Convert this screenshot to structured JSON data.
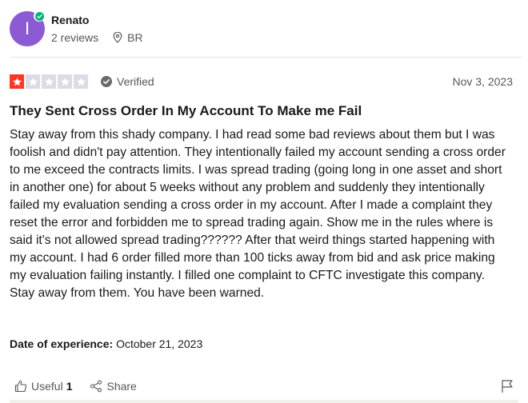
{
  "reviewer": {
    "avatar_initial": "I",
    "name": "Renato",
    "reviews_count": "2 reviews",
    "location": "BR",
    "avatar_color": "#8c5ad2"
  },
  "rating": {
    "stars_filled": 1,
    "stars_total": 5,
    "verified_label": "Verified",
    "date": "Nov 3, 2023",
    "star_color": "#ff3722"
  },
  "review": {
    "title": "They Sent Cross Order In My Account To Make me Fail",
    "body": "Stay away from this shady company. I had read some bad reviews about them but I was foolish and didn't pay attention. They intentionally failed my account sending a cross order to me exceed the contracts limits. I was spread trading (going long in one asset and short in another one) for about 5 weeks without any problem and suddenly they intentionally failed my evaluation sending a cross order in my account. After I made a complaint they reset the error and forbidden me to spread trading again. Show me in the rules where is said it's not allowed spread trading?????? After that weird things started happening with my account. I had 6 order filled more than 100 ticks away from bid and ask price making my evaluation failing instantly. I filled one complaint to CFTC investigate this company. Stay away from them. You have been warned.",
    "experience_label": "Date of experience:",
    "experience_date": "October 21, 2023"
  },
  "actions": {
    "useful_label": "Useful",
    "useful_count": "1",
    "share_label": "Share"
  }
}
